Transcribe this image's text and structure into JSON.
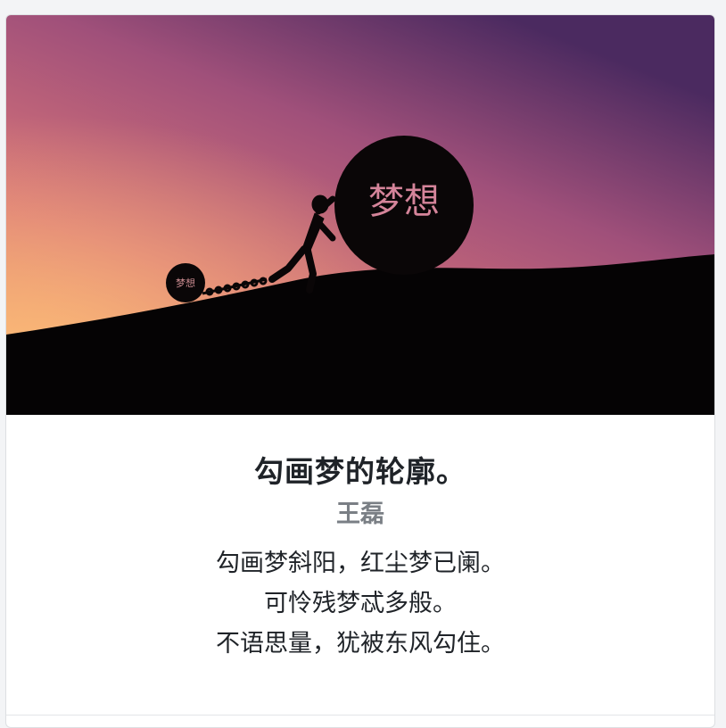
{
  "card": {
    "image_alt_text": "梦想",
    "big_stone_label": "梦想",
    "small_stone_label": "梦想",
    "title": "勾画梦的轮廓。",
    "author": "王磊",
    "poem_lines": [
      "勾画梦斜阳，红尘梦已阑。",
      "可怜残梦忒多般。",
      "不语思量，犹被东风勾住。"
    ]
  },
  "colors": {
    "sky_top": "#4a2a5e",
    "sky_mid": "#b35b78",
    "sky_bottom": "#f0a066",
    "ground": "#050304",
    "title_text": "#1f2328",
    "author_text": "#7a7f85"
  }
}
